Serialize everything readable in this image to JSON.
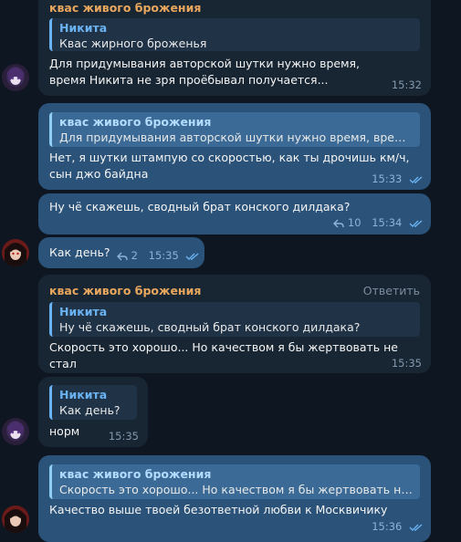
{
  "messages": [
    {
      "sender": "квас живого брожения",
      "quote_name": "Никита",
      "quote_text": "Квас жирного броженья",
      "text": "Для придумывания авторской шутки нужно время, время Никита не зря проёбывал получается...",
      "time": "15:32"
    },
    {
      "quote_name": "квас живого брожения",
      "quote_text": "Для придумывания авторской шутки нужно время, время Н...",
      "text": "Нет, я шутки штампую со скоростью, как ты дрочишь км/ч, сын джо байдна",
      "time": "15:33"
    },
    {
      "text": "Ну чё скажешь, сводный брат конского дилдака?",
      "replies": "10",
      "time": "15:34"
    },
    {
      "text": "Как день?",
      "replies": "2",
      "time": "15:35"
    },
    {
      "sender": "квас живого брожения",
      "action": "Ответить",
      "quote_name": "Никита",
      "quote_text": "Ну чё скажешь, сводный брат конского дилдака?",
      "text": "Скорость это хорошо... Но качеством я бы жертвовать не стал",
      "time": "15:35"
    },
    {
      "quote_name": "Никита",
      "quote_text": "Как день?",
      "text": "норм",
      "time": "15:35"
    },
    {
      "quote_name": "квас живого брожения",
      "quote_text": "Скорость это хорошо... Но качеством я бы жертвовать не стал",
      "text": "Качество выше твоей безответной любви к Москвичику",
      "time": "15:36"
    }
  ]
}
